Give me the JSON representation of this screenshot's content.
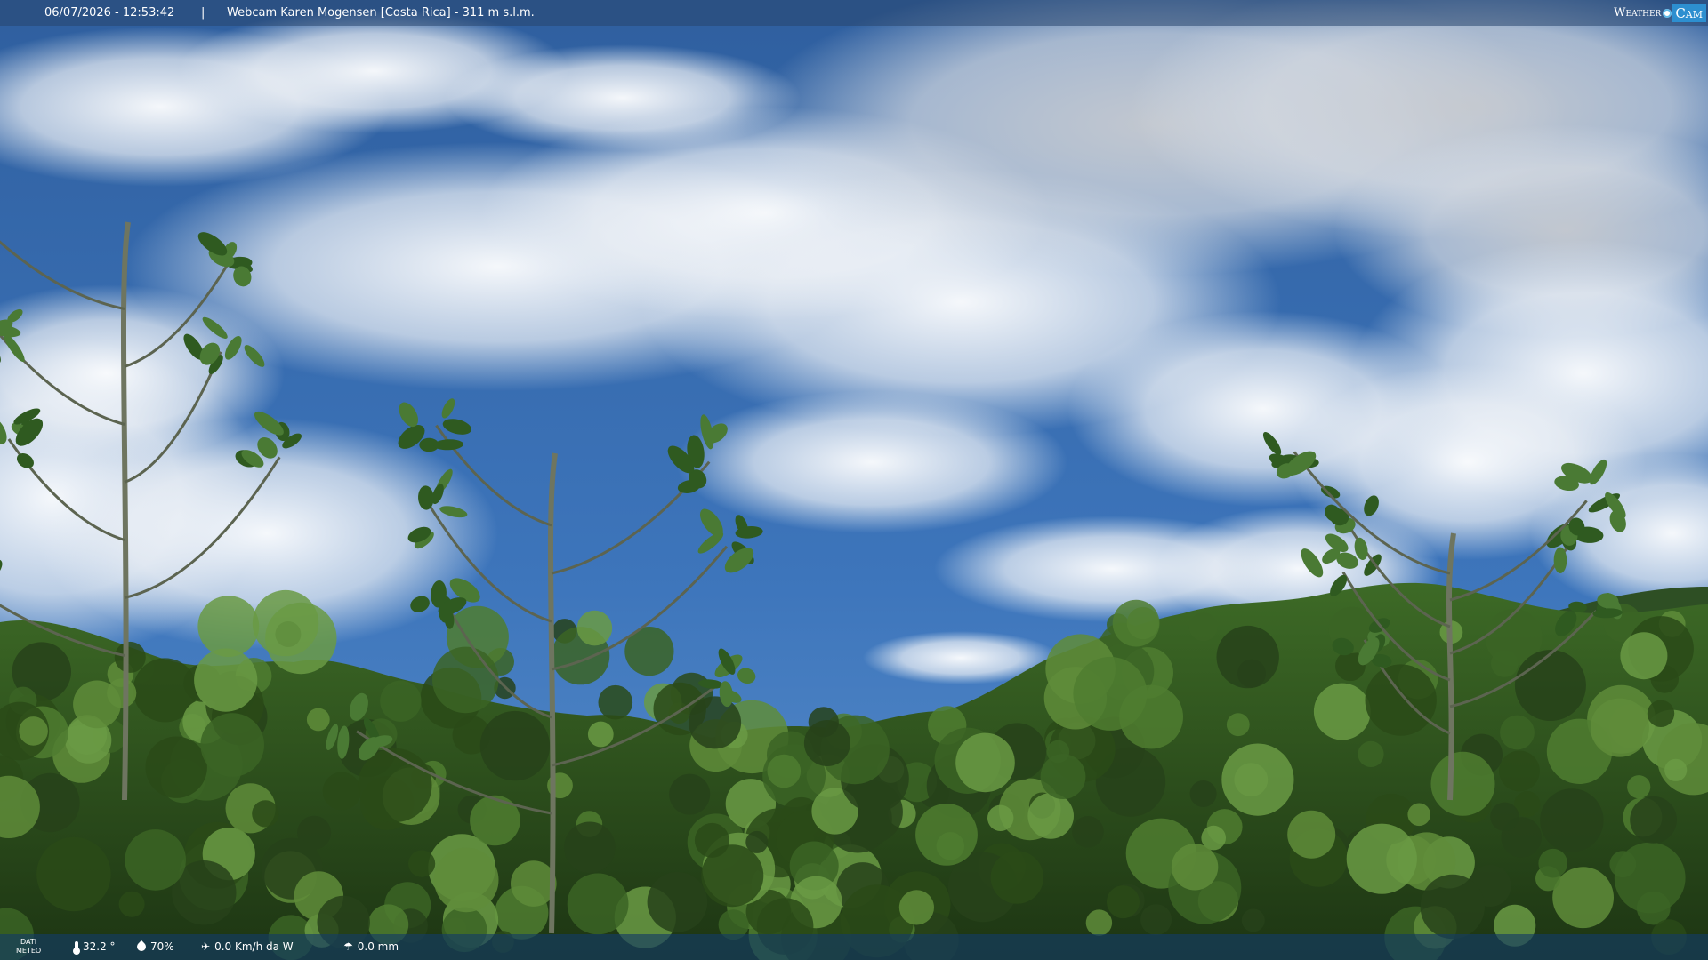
{
  "header": {
    "timestamp": "06/07/2026 - 12:53:42",
    "separator": "|",
    "camera_label": "Webcam Karen Mogensen [Costa Rica] - 311 m s.l.m.",
    "logo_weather": "Weather",
    "logo_cam": "Cam"
  },
  "footer": {
    "dati_line1": "DATI",
    "dati_line2": "METEO",
    "temperature": "32.2 °",
    "humidity": "70%",
    "wind": "0.0 Km/h da W",
    "rain": "0.0 mm",
    "icons": [
      "thermometer-icon",
      "humidity-icon",
      "wind-icon",
      "rain-icon"
    ]
  },
  "colors": {
    "sky_top": "#2f62a8",
    "sky_bottom": "#4a82c4",
    "cloud": "#ffffff",
    "forest_dark": "#1f3a14",
    "forest_mid": "#3f6e26",
    "forest_light": "#6f9a48",
    "bar": "#284a6e"
  }
}
